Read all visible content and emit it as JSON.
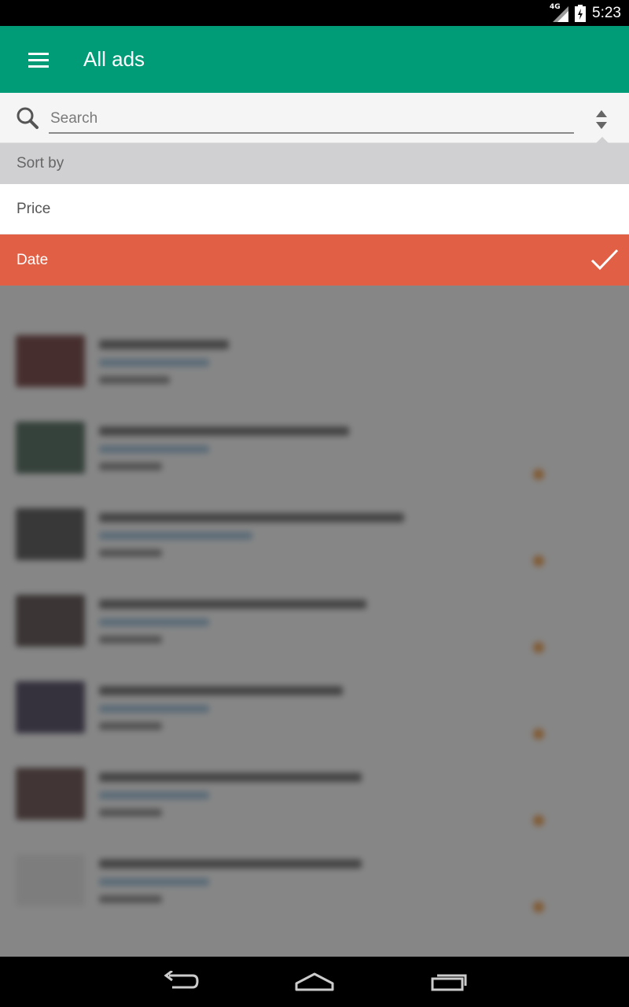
{
  "status_bar": {
    "network": "4G",
    "time": "5:23"
  },
  "app_bar": {
    "title": "All ads",
    "menu_icon": "hamburger-menu-icon"
  },
  "search": {
    "placeholder": "Search",
    "value": ""
  },
  "sort_menu": {
    "header": "Sort by",
    "options": [
      {
        "label": "Price",
        "selected": false
      },
      {
        "label": "Date",
        "selected": true
      }
    ],
    "selected_color": "#e05f45"
  },
  "colors": {
    "app_bar": "#009b77",
    "accent": "#e05f45"
  },
  "nav_bar": {
    "icons": [
      "back-icon",
      "home-icon",
      "recent-apps-icon"
    ]
  }
}
